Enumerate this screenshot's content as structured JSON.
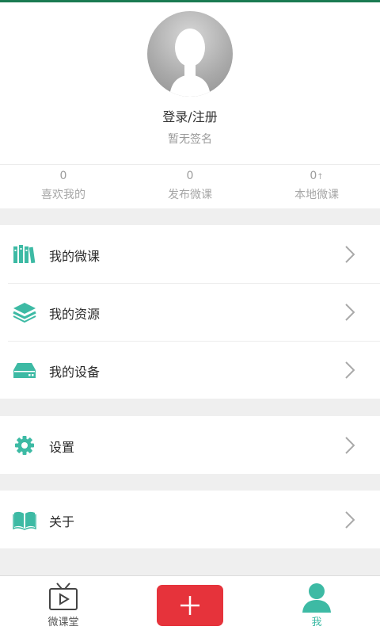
{
  "profile": {
    "username": "登录/注册",
    "signature": "暂无签名"
  },
  "stats": [
    {
      "count": "0",
      "label": "喜欢我的"
    },
    {
      "count": "0",
      "label": "发布微课"
    },
    {
      "count": "0",
      "suffix": "↑",
      "label": "本地微课"
    }
  ],
  "menu": {
    "my_courses": "我的微课",
    "my_resources": "我的资源",
    "my_devices": "我的设备",
    "settings": "设置",
    "about": "关于"
  },
  "tabbar": {
    "classroom": "微课堂",
    "add": "+",
    "me": "我"
  },
  "colors": {
    "accent": "#3dbaa4",
    "add_button": "#e6333b",
    "top_line": "#1a7a52"
  }
}
